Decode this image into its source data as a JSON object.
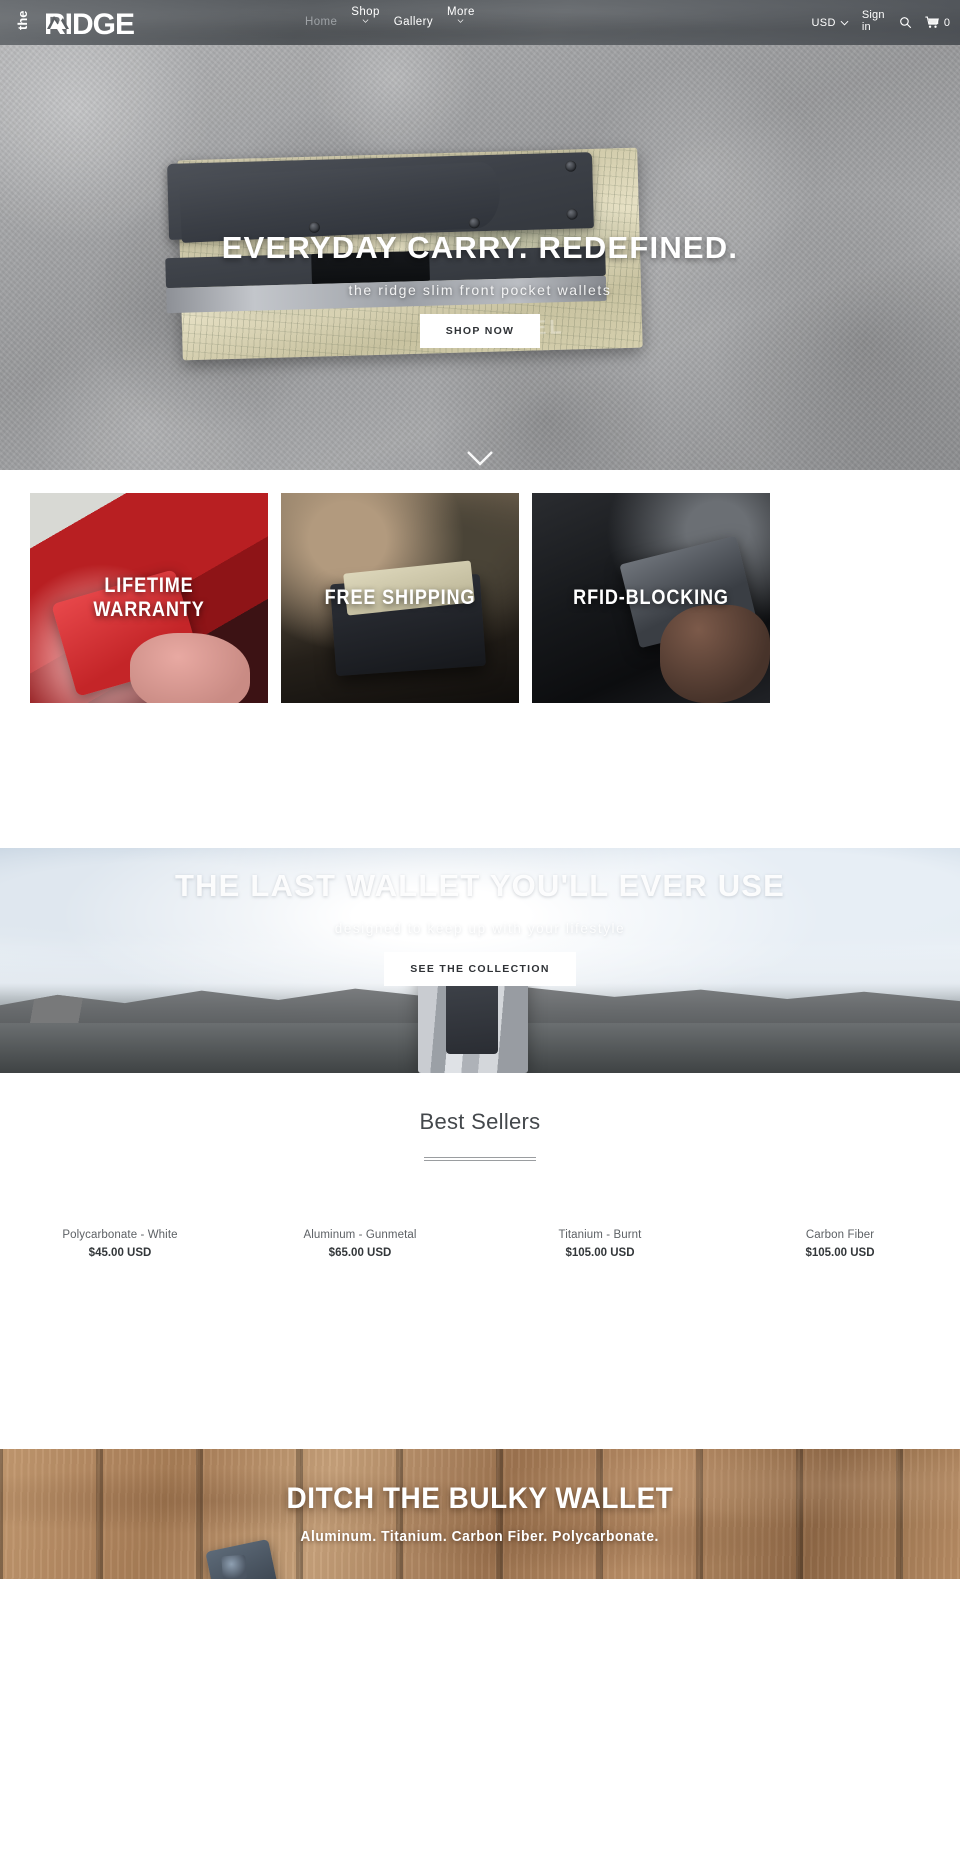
{
  "header": {
    "logo": {
      "pre": "the",
      "main": "RIDGE",
      "name": "the RIDGE"
    },
    "nav": [
      {
        "label": "Home",
        "caret": false,
        "active": true
      },
      {
        "label": "Shop",
        "caret": true,
        "active": false
      },
      {
        "label": "Gallery",
        "caret": false,
        "active": false
      },
      {
        "label": "More",
        "caret": true,
        "active": false
      }
    ],
    "currency": {
      "label": "USD",
      "icon": "chevron-down-icon"
    },
    "sign_in": "Sign in",
    "search_icon": "search-icon",
    "cart": {
      "icon": "cart-icon",
      "count": "0"
    }
  },
  "hero": {
    "title": "EVERYDAY CARRY. REDEFINED.",
    "subtitle": "the ridge slim front pocket wallets",
    "button": "SHOP NOW",
    "scroll_icon": "chevron-down-icon",
    "engrave_text": "TRAVEL"
  },
  "tiles": [
    {
      "label": "LIFETIME WARRANTY",
      "name": "tile-lifetime-warranty"
    },
    {
      "label": "FREE SHIPPING",
      "name": "tile-free-shipping"
    },
    {
      "label": "RFID-BLOCKING",
      "name": "tile-rfid-blocking"
    }
  ],
  "sky_banner": {
    "title": "THE LAST WALLET YOU'LL EVER USE",
    "subtitle": "designed to keep up with your lifestyle",
    "button": "SEE THE COLLECTION"
  },
  "best_sellers": {
    "title": "Best Sellers",
    "products": [
      {
        "name": "Polycarbonate - White",
        "price": "$45.00 USD"
      },
      {
        "name": "Aluminum - Gunmetal",
        "price": "$65.00 USD"
      },
      {
        "name": "Titanium - Burnt",
        "price": "$105.00 USD"
      },
      {
        "name": "Carbon Fiber",
        "price": "$105.00 USD"
      }
    ]
  },
  "wood_banner": {
    "title": "DITCH THE BULKY WALLET",
    "subtitle": "Aluminum. Titanium. Carbon Fiber. Polycarbonate."
  },
  "colors": {
    "header_bg": "#5b5f63",
    "button_bg": "#ffffff",
    "text_dark": "#33373a",
    "text_muted": "#5d6165"
  }
}
